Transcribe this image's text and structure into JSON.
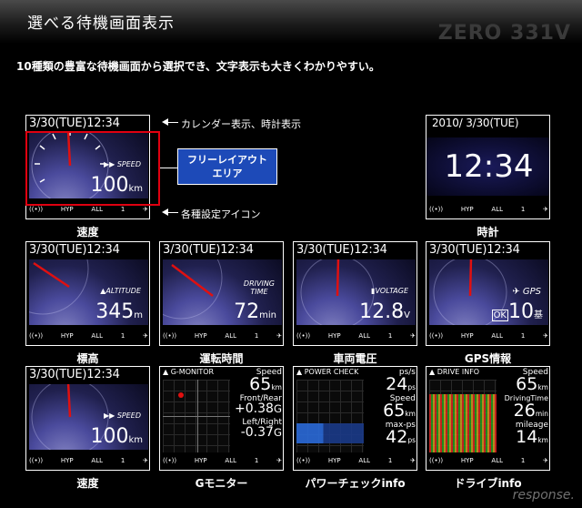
{
  "header": {
    "title": "選べる待機画面表示",
    "brand": "ZERO 331V"
  },
  "intro": "10種類の豊富な待機画面から選択でき、文字表示も大きくわかりやすい。",
  "date_text": "3/30(TUE)12:34",
  "icons": {
    "hyp": "HYP",
    "all": "ALL",
    "n1": "1"
  },
  "annotations": {
    "calendar": "カレンダー表示、時計表示",
    "icons": "各種設定アイコン",
    "free_layout_line1": "フリーレイアウト",
    "free_layout_line2": "エリア"
  },
  "panels": {
    "speed": {
      "label": "SPEED",
      "value": "100",
      "unit_top": "km",
      "unit_bottom": "h",
      "caption": "速度"
    },
    "clock": {
      "date": "2010/  3/30(TUE)",
      "time": "12:34",
      "caption": "時計"
    },
    "altitude": {
      "label": "ALTITUDE",
      "value": "345",
      "unit": "m",
      "caption": "標高"
    },
    "driving": {
      "label_top": "DRIVING",
      "label_bottom": "TIME",
      "value": "72",
      "unit": "min",
      "caption": "運転時間"
    },
    "voltage": {
      "label": "VOLTAGE",
      "value": "12.8",
      "unit": "V",
      "caption": "車両電圧"
    },
    "gps": {
      "label": "GPS",
      "ok": "OK",
      "value": "10",
      "unit": "基",
      "caption": "GPS情報"
    },
    "speed2": {
      "label": "SPEED",
      "value": "100",
      "unit_top": "km",
      "unit_bottom": "h",
      "caption": "速度"
    },
    "gmonitor": {
      "title": "G-MONITOR",
      "speed_label": "Speed",
      "speed_value": "65",
      "speed_unit_top": "km",
      "speed_unit_bottom": "h",
      "fr_label": "Front/Rear",
      "fr_value": "+0.38",
      "fr_unit": "G",
      "lr_label": "Left/Right",
      "lr_value": "-0.37",
      "lr_unit": "G",
      "caption": "Gモニター"
    },
    "power": {
      "title": "POWER CHECK",
      "psps_label": "ps/s",
      "psps_value": "24",
      "psps_unit": "ps",
      "speed_label": "Speed",
      "speed_value": "65",
      "speed_unit_top": "km",
      "speed_unit_bottom": "h",
      "maxps_label": "max-ps",
      "maxps_value": "42",
      "maxps_unit": "ps",
      "caption": "パワーチェックinfo"
    },
    "drive": {
      "title": "DRIVE INFO",
      "speed_label": "Speed",
      "speed_value": "65",
      "speed_unit_top": "km",
      "speed_unit_bottom": "h",
      "dt_label": "DrivingTime",
      "dt_value": "26",
      "dt_unit": "min",
      "mil_label": "mileage",
      "mil_value": "14",
      "mil_unit": "km",
      "caption": "ドライブinfo"
    }
  },
  "watermark": "response.",
  "colors": {
    "highlight_border": "#e00010",
    "free_area_bg": "#1d4ab8",
    "needle": "#e01010"
  }
}
